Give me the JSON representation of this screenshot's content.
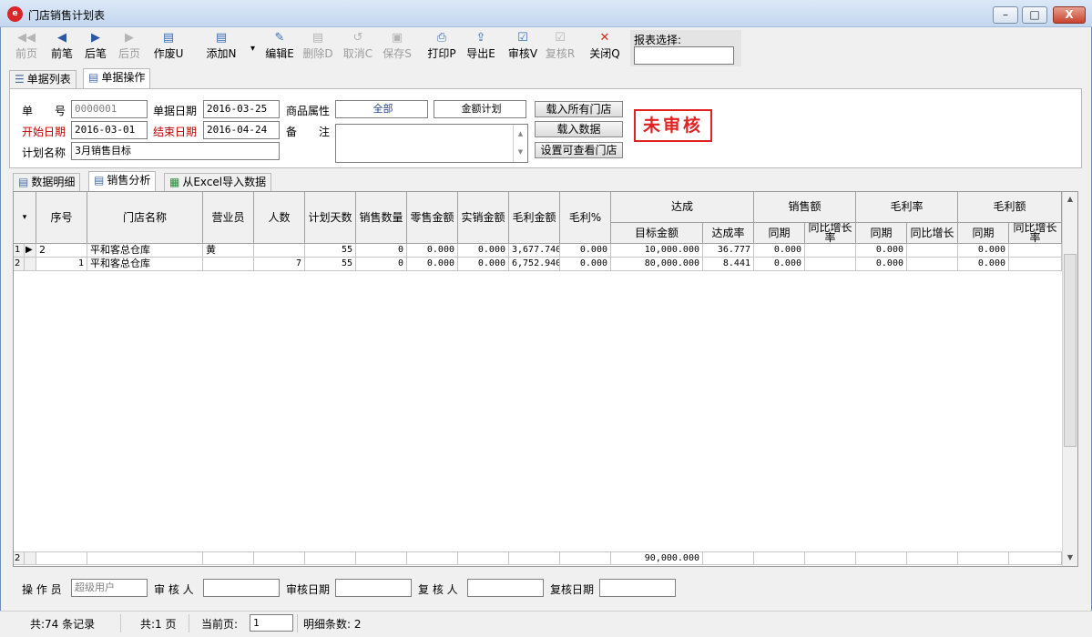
{
  "window": {
    "app_icon": "app-logo-icon",
    "title": "门店销售计划表",
    "minimize": "–",
    "restore": "□",
    "close": "X"
  },
  "toolbar": [
    {
      "id": "first",
      "label": "前页",
      "icon": "double-left-arrow-icon",
      "glyph": "◀◀",
      "disabled": true
    },
    {
      "id": "prev",
      "label": "前笔",
      "icon": "left-arrow-icon",
      "glyph": "◀",
      "disabled": false
    },
    {
      "id": "next",
      "label": "后笔",
      "icon": "right-arrow-icon",
      "glyph": "▶",
      "disabled": false
    },
    {
      "id": "last",
      "label": "后页",
      "icon": "right-arrow-gray-icon",
      "glyph": "▶",
      "disabled": true
    },
    {
      "id": "void",
      "label": "作废U",
      "icon": "void-document-icon",
      "glyph": "▤",
      "disabled": false
    },
    {
      "id": "add",
      "label": "添加N",
      "icon": "add-document-icon",
      "glyph": "▤",
      "disabled": false
    },
    {
      "id": "edit",
      "label": "编辑E",
      "icon": "edit-document-icon",
      "glyph": "✎",
      "disabled": false
    },
    {
      "id": "delete",
      "label": "删除D",
      "icon": "delete-document-icon",
      "glyph": "▤",
      "disabled": true
    },
    {
      "id": "cancel",
      "label": "取消C",
      "icon": "undo-icon",
      "glyph": "↺",
      "disabled": true
    },
    {
      "id": "save",
      "label": "保存S",
      "icon": "save-disk-icon",
      "glyph": "▣",
      "disabled": true
    },
    {
      "id": "print",
      "label": "打印P",
      "icon": "printer-icon",
      "glyph": "⎙",
      "disabled": false
    },
    {
      "id": "export",
      "label": "导出E",
      "icon": "export-icon",
      "glyph": "⇪",
      "disabled": false
    },
    {
      "id": "audit",
      "label": "审核V",
      "icon": "audit-check-icon",
      "glyph": "☑",
      "disabled": false
    },
    {
      "id": "reaudit",
      "label": "复核R",
      "icon": "reaudit-check-icon",
      "glyph": "☑",
      "disabled": true
    },
    {
      "id": "closewin",
      "label": "关闭Q",
      "icon": "close-x-icon",
      "glyph": "✕",
      "disabled": false
    }
  ],
  "add_dropdown_icon": "▾",
  "report_select_label": "报表选择:",
  "tabs": {
    "list": "单据列表",
    "ops": "单据操作",
    "list_icon": "list-icon",
    "ops_icon": "form-icon"
  },
  "header": {
    "doc_no_label": "单　　号",
    "doc_no": "0000001",
    "doc_date_label": "单据日期",
    "doc_date": "2016-03-25",
    "attr_label": "商品属性",
    "attr_value": "全部",
    "plan_type": "金额计划",
    "start_date_label": "开始日期",
    "start_date": "2016-03-01",
    "end_date_label": "结束日期",
    "end_date": "2016-04-24",
    "note_label": "备　　注",
    "plan_name_label": "计划名称",
    "plan_name": "3月销售目标",
    "btn_load_all": "载入所有门店",
    "btn_load_data": "载入数据",
    "btn_set_visible": "设置可查看门店",
    "stamp": "未审核"
  },
  "subtabs": {
    "detail": "数据明细",
    "sales": "销售分析",
    "excel": "从Excel导入数据"
  },
  "grid": {
    "headers": {
      "seq": "序号",
      "store": "门店名称",
      "clerk": "营业员",
      "people": "人数",
      "plan_days": "计划天数",
      "sales_qty": "销售数量",
      "retail_amt": "零售金额",
      "actual_amt": "实销金额",
      "gp_amt": "毛利金额",
      "gp_pct": "毛利%",
      "achieve": "达成",
      "target_amt": "目标金额",
      "achieve_rate": "达成率",
      "sales": "销售额",
      "sales_prior": "同期",
      "sales_yoy": "同比增长率",
      "gp_rate": "毛利率",
      "gpr_prior": "同期",
      "gpr_yoy": "同比增长",
      "gp_total": "毛利额",
      "gpt_prior": "同期",
      "gpt_yoy": "同比增长率"
    },
    "rows": [
      {
        "rownum": "1",
        "marker": "▶",
        "seq": "2",
        "store": "平和客总仓库",
        "clerk": "黄",
        "people": "",
        "plan_days": "55",
        "sales_qty": "0",
        "retail_amt": "0.000",
        "actual_amt": "0.000",
        "gp_amt": "3,677.740",
        "gp_pct": "0.000",
        "target_amt": "10,000.000",
        "achieve_rate": "36.777",
        "sales_prior": "0.000",
        "sales_yoy": "",
        "gpr_prior": "0.000",
        "gpr_yoy": "",
        "gpt_prior": "0.000",
        "gpt_yoy": ""
      },
      {
        "rownum": "2",
        "marker": "",
        "seq": "1",
        "store": "平和客总仓库",
        "clerk": "",
        "people": "7",
        "plan_days": "55",
        "sales_qty": "0",
        "retail_amt": "0.000",
        "actual_amt": "0.000",
        "gp_amt": "6,752.940",
        "gp_pct": "0.000",
        "target_amt": "80,000.000",
        "achieve_rate": "8.441",
        "sales_prior": "0.000",
        "sales_yoy": "",
        "gpr_prior": "0.000",
        "gpr_yoy": "",
        "gpt_prior": "0.000",
        "gpt_yoy": ""
      }
    ],
    "footer": {
      "rownum": "2",
      "target_total": "90,000.000"
    },
    "corner_glyph": "▾",
    "scroll_up": "▲",
    "scroll_down": "▼"
  },
  "footer": {
    "operator_label": "操 作 员",
    "operator": "超级用户",
    "auditor_label": "审 核 人",
    "audit_date_label": "审核日期",
    "reviewer_label": "复 核 人",
    "review_date_label": "复核日期"
  },
  "status": {
    "total_records": "共:74 条记录",
    "total_pages": "共:1 页",
    "current_page_label": "当前页:",
    "current_page": "1",
    "detail_count": "明细条数: 2"
  }
}
